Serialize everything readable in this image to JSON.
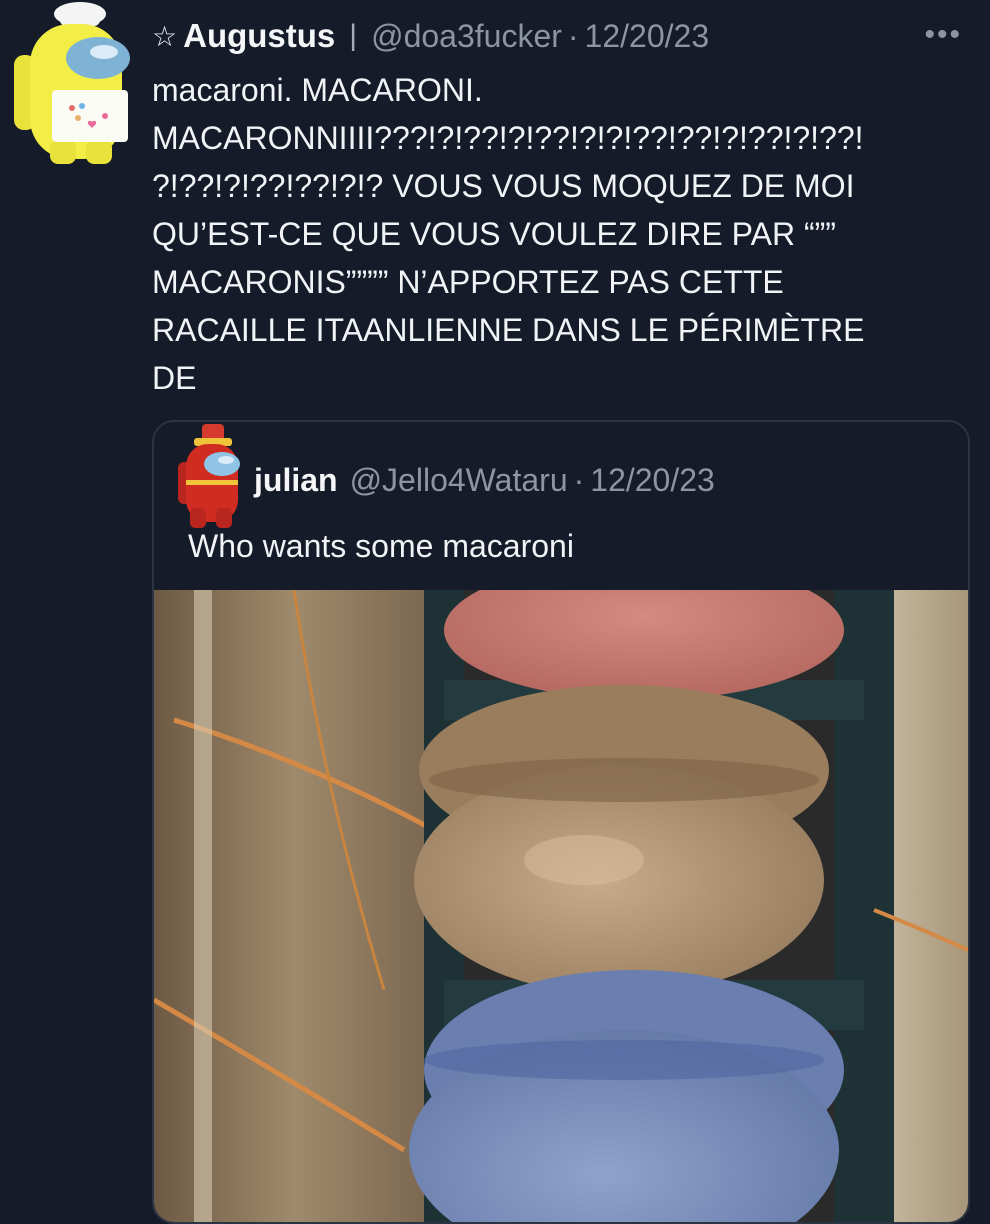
{
  "tweet": {
    "star": "☆",
    "display_name": "Augustus",
    "separator": "|",
    "handle": "@doa3fucker",
    "dot": "·",
    "date": "12/20/23",
    "more": "•••",
    "text": "macaroni. MACARONI.\nMACARONNIIII???!?!??!?!??!?!?!??!??!?!??!?!??!\n?!??!?!??!??!?!? VOUS VOUS MOQUEZ DE MOI\nQU’EST-CE QUE VOUS VOULEZ DIRE PAR “””\nMACARONIS”””” N’APPORTEZ PAS CETTE\nRACAILLE ITAANLIENNE DANS LE PÉRIMÈTRE\nDE"
  },
  "quoted": {
    "display_name": "julian",
    "handle": "@Jello4Wataru",
    "dot": "·",
    "date": "12/20/23",
    "text": "Who wants some macaroni"
  },
  "colors": {
    "background": "#151b28",
    "text": "#f1f3f6",
    "muted": "#8c95a1",
    "border": "#2b3442"
  }
}
